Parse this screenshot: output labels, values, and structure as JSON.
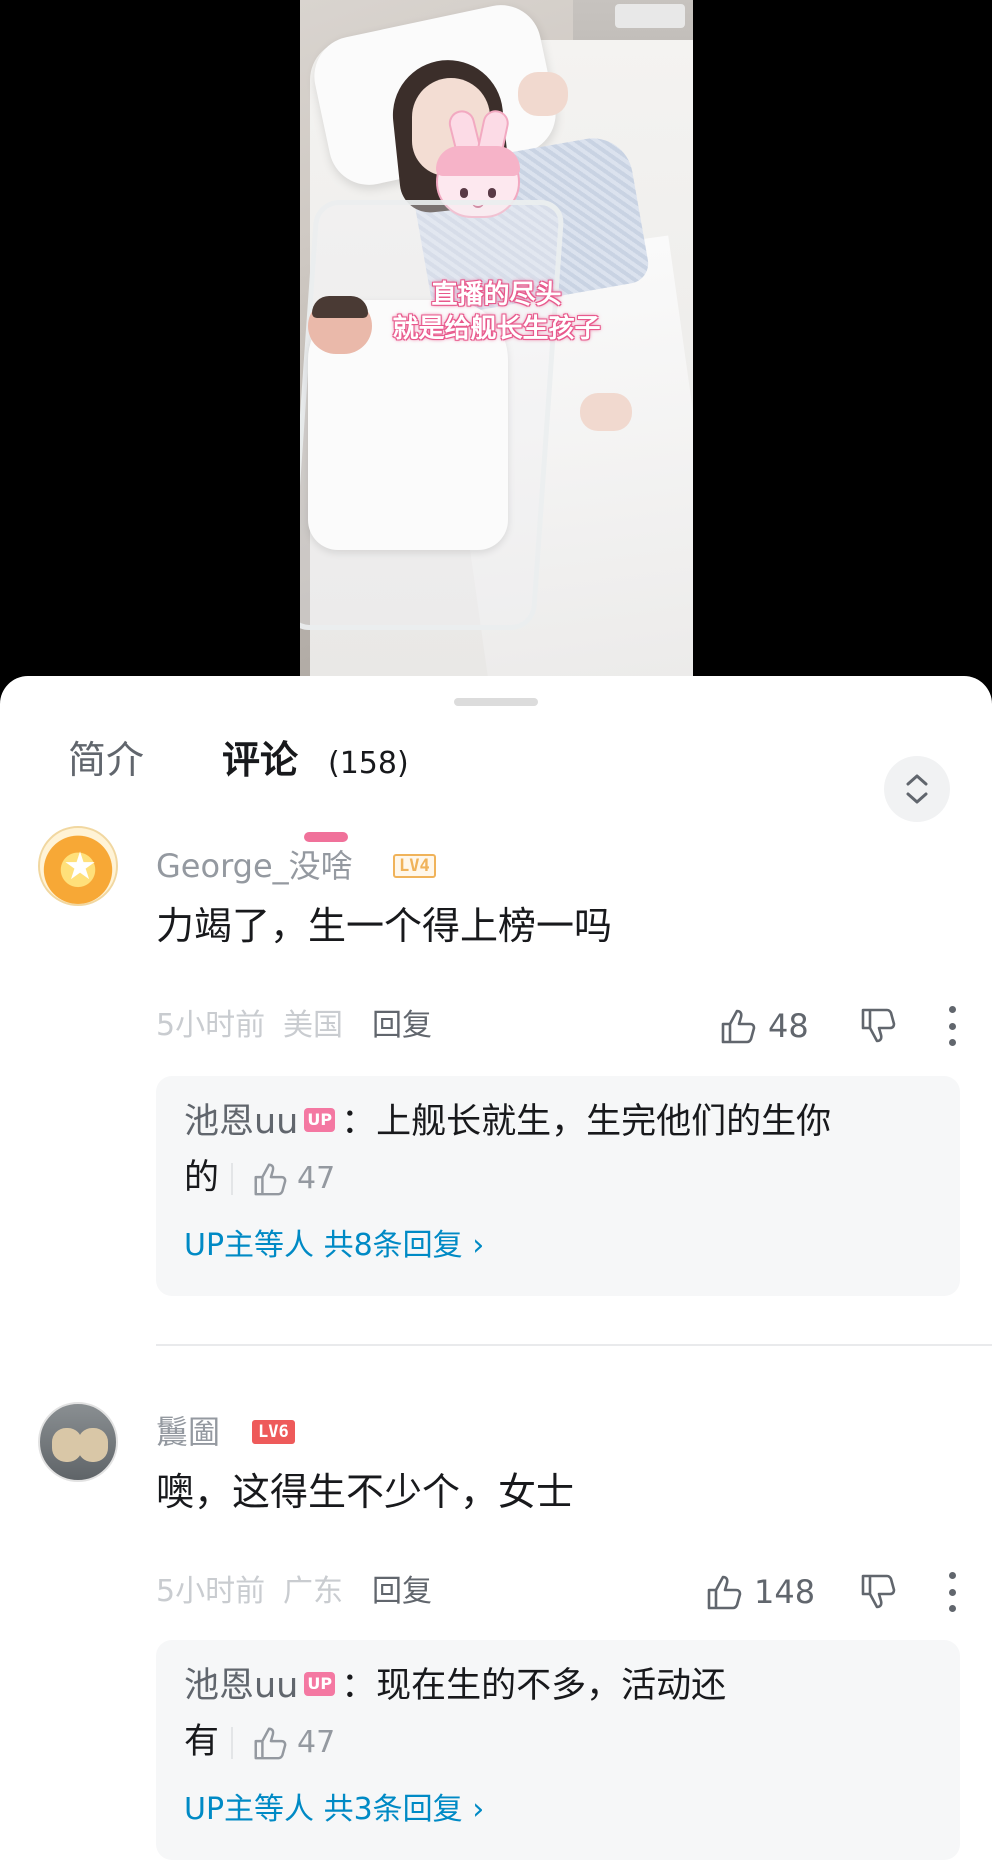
{
  "video": {
    "caption_line1": "直播的尽头",
    "caption_line2": "就是给舰长生孩子"
  },
  "tabs": {
    "intro_label": "简介",
    "comments_label": "评论",
    "comments_count": "(158)"
  },
  "comments": [
    {
      "username": "George_没啥",
      "level": "LV4",
      "text": "力竭了，生一个得上榜一吗",
      "time": "5小时前",
      "location": "美国",
      "reply_label": "回复",
      "likes": "48",
      "reply": {
        "author": "池恩uu",
        "badge": "UP",
        "text_line1": "：上舰长就生，生完他们的生你",
        "text_line2": "的",
        "likes": "47",
        "more": "UP主等人 共8条回复"
      }
    },
    {
      "username": "鬞圗",
      "level": "LV6",
      "text": "噢，这得生不少个，女士",
      "time": "5小时前",
      "location": "广东",
      "reply_label": "回复",
      "likes": "148",
      "reply": {
        "author": "池恩uu",
        "badge": "UP",
        "text_line1": "：现在生的不多，活动还",
        "text_line2": "有",
        "likes": "47",
        "more": "UP主等人 共3条回复"
      }
    }
  ],
  "colors": {
    "accent_pink": "#f0719a",
    "link_blue": "#008ac5",
    "up_badge": "#f478a2",
    "lv4": "#f0b35a",
    "lv6": "#ee5a5a"
  },
  "icons": [
    "thumb-up-icon",
    "thumb-down-icon",
    "more-icon",
    "chevron-right-icon",
    "expand-icon"
  ]
}
